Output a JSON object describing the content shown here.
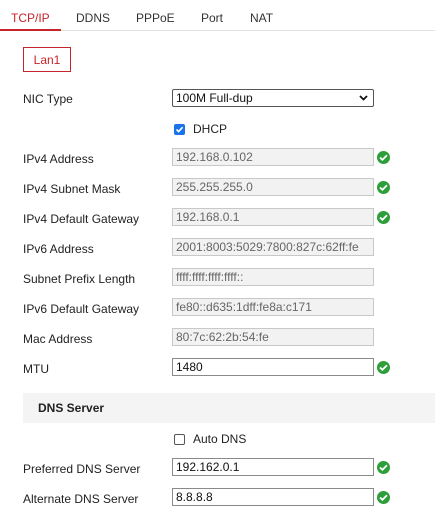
{
  "tabs": [
    {
      "label": "TCP/IP",
      "active": true
    },
    {
      "label": "DDNS",
      "active": false
    },
    {
      "label": "PPPoE",
      "active": false
    },
    {
      "label": "Port",
      "active": false
    },
    {
      "label": "NAT",
      "active": false
    }
  ],
  "subtab": {
    "label": "Lan1"
  },
  "nic_type": {
    "label": "NIC Type",
    "value": "100M Full-dup"
  },
  "dhcp": {
    "label": "DHCP",
    "checked": true
  },
  "ipv4_address": {
    "label": "IPv4 Address",
    "value": "192.168.0.102"
  },
  "ipv4_subnet_mask": {
    "label": "IPv4 Subnet Mask",
    "value": "255.255.255.0"
  },
  "ipv4_default_gateway": {
    "label": "IPv4 Default Gateway",
    "value": "192.168.0.1"
  },
  "ipv6_address": {
    "label": "IPv6 Address",
    "value": "2001:8003:5029:7800:827c:62ff:fe"
  },
  "subnet_prefix_length": {
    "label": "Subnet Prefix Length",
    "value": "ffff:ffff:ffff:ffff::"
  },
  "ipv6_default_gateway": {
    "label": "IPv6 Default Gateway",
    "value": "fe80::d635:1dff:fe8a:c171"
  },
  "mac_address": {
    "label": "Mac Address",
    "value": "80:7c:62:2b:54:fe"
  },
  "mtu": {
    "label": "MTU",
    "value": "1480"
  },
  "dns_section": {
    "title": "DNS Server"
  },
  "auto_dns": {
    "label": "Auto DNS",
    "checked": false
  },
  "preferred_dns": {
    "label": "Preferred DNS Server",
    "value": "192.162.0.1"
  },
  "alternate_dns": {
    "label": "Alternate DNS Server",
    "value": "8.8.8.8"
  },
  "colors": {
    "accent": "#c5242b",
    "ok": "#2e9e3a",
    "checkbox": "#1a73e8"
  },
  "icons": {
    "valid": "check-circle-icon",
    "dropdown": "chevron-down-icon"
  }
}
